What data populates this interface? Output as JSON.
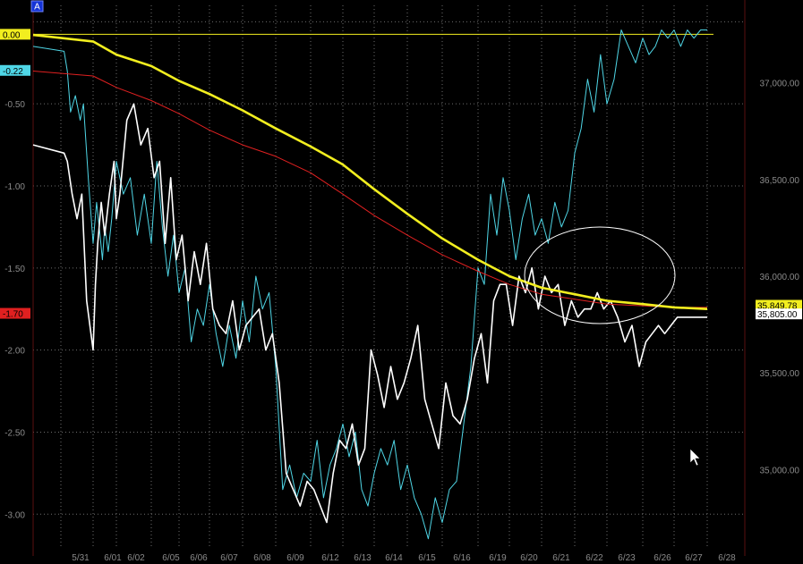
{
  "chart_data": {
    "type": "line",
    "corner_badge": "A",
    "colors": {
      "background": "#000000",
      "grid": "#6e6e6e",
      "left_axis": "#8a8a8a",
      "right_axis": "#8b1a1a",
      "white_series": "#ffffff",
      "cyan_series": "#4fd6e6",
      "yellow_series": "#f2ee1f",
      "red_series": "#e02020",
      "ellipse": "#ffffff"
    },
    "x_labels": [
      "5/31",
      "6/01",
      "6/02",
      "6/05",
      "6/06",
      "6/07",
      "6/08",
      "6/09",
      "6/12",
      "6/13",
      "6/14",
      "6/15",
      "6/16",
      "6/19",
      "6/20",
      "6/21",
      "6/22",
      "6/23",
      "6/26",
      "6/27",
      "6/28"
    ],
    "left_axis": {
      "ylim": [
        -3.2,
        0.1
      ],
      "ticks": [
        0.0,
        -0.5,
        -1.0,
        -1.5,
        -2.0,
        -2.5,
        -3.0
      ],
      "tick_labels": [
        "0.00",
        "-0.50",
        "-1.00",
        "-1.50",
        "-2.00",
        "-2.50",
        "-3.00"
      ],
      "tick_label_shown": [
        false,
        true,
        true,
        true,
        true,
        true,
        true
      ]
    },
    "right_axis": {
      "ylim": [
        34600,
        37400
      ],
      "ticks": [
        37000,
        36500,
        36000,
        35500,
        35000
      ],
      "tick_labels": [
        "37,000.00",
        "36,500.00",
        "36,000.00",
        "35,500.00",
        "35,000.00"
      ]
    },
    "value_tags": [
      {
        "side": "left",
        "text": "0.00",
        "value": 0.0,
        "bg": "#f2ee1f",
        "fg": "#000000"
      },
      {
        "side": "left",
        "text": "-0.22",
        "value": -0.22,
        "bg": "#4fd6e6",
        "fg": "#000000"
      },
      {
        "side": "left",
        "text": "-1.70",
        "value": -1.7,
        "bg": "#e02020",
        "fg": "#000000"
      },
      {
        "side": "right",
        "text": "35,849.78",
        "value": 35849.78,
        "bg": "#f2ee1f",
        "fg": "#000000"
      },
      {
        "side": "right",
        "text": "35,805.00",
        "value": 35805.0,
        "bg": "#ffffff",
        "fg": "#000000"
      }
    ],
    "reference_line": {
      "axis": "left",
      "value": 0.0,
      "color": "#f2ee1f"
    },
    "series": [
      {
        "axis": "left",
        "color_key": "cyan_series",
        "width": 1,
        "x": [
          0.0,
          0.1,
          0.2,
          0.3,
          0.45,
          0.6,
          0.7,
          0.85,
          1.0,
          1.15,
          1.3,
          1.4,
          1.5,
          1.65,
          1.8,
          2.0,
          2.2,
          2.4,
          2.6,
          2.8,
          3.0,
          3.2,
          3.4,
          3.6,
          3.8,
          4.0,
          4.2,
          4.4,
          4.6,
          4.8,
          5.0,
          5.2,
          5.4,
          5.6,
          5.8,
          6.0,
          6.2,
          6.4,
          6.6,
          6.8,
          7.0,
          7.2,
          7.4,
          7.6,
          7.8,
          8.0,
          8.2,
          8.4,
          8.6,
          8.8,
          9.0,
          9.2,
          9.4,
          9.6,
          9.8,
          10.0,
          10.2,
          10.4,
          10.6,
          10.8,
          11.0,
          11.2,
          11.4,
          11.6,
          11.8,
          12.0,
          12.2,
          12.4,
          12.6,
          12.8,
          13.0,
          13.2,
          13.4,
          13.6,
          13.8,
          14.0,
          14.2,
          14.4,
          14.6,
          14.8,
          15.0,
          15.2,
          15.4,
          15.6,
          15.8,
          16.0,
          16.2,
          16.4,
          16.6,
          16.8,
          17.0,
          17.2,
          17.4,
          17.6,
          17.8,
          18.0,
          18.2,
          18.4,
          18.6,
          18.8,
          19.0,
          19.2,
          19.4,
          19.6,
          19.8,
          20.0
        ],
        "values": [
          -0.15,
          -0.18,
          -0.3,
          -0.55,
          -0.45,
          -0.6,
          -0.5,
          -0.95,
          -1.35,
          -1.1,
          -1.3,
          -1.45,
          -1.25,
          -1.4,
          -1.2,
          -0.85,
          -1.05,
          -0.95,
          -1.3,
          -1.05,
          -1.35,
          -0.85,
          -1.25,
          -1.55,
          -1.3,
          -1.65,
          -1.5,
          -1.95,
          -1.75,
          -1.85,
          -1.6,
          -1.9,
          -2.1,
          -1.85,
          -2.05,
          -1.7,
          -1.95,
          -1.55,
          -1.75,
          -1.65,
          -2.1,
          -2.85,
          -2.7,
          -2.9,
          -2.75,
          -2.8,
          -2.55,
          -2.9,
          -2.7,
          -2.6,
          -2.45,
          -2.65,
          -2.5,
          -2.85,
          -2.95,
          -2.75,
          -2.6,
          -2.7,
          -2.55,
          -2.85,
          -2.7,
          -2.9,
          -3.0,
          -3.15,
          -2.9,
          -3.05,
          -2.85,
          -2.8,
          -2.45,
          -2.1,
          -1.5,
          -1.6,
          -1.05,
          -1.3,
          -0.95,
          -1.15,
          -1.45,
          -1.2,
          -1.05,
          -1.3,
          -1.2,
          -1.35,
          -1.1,
          -1.25,
          -1.15,
          -0.8,
          -0.65,
          -0.35,
          -0.55,
          -0.2,
          -0.5,
          -0.35,
          -0.05,
          -0.15,
          -0.25,
          -0.1,
          -0.2,
          -0.15,
          -0.05,
          -0.1,
          -0.05,
          -0.15,
          -0.05,
          -0.1,
          -0.05,
          -0.05
        ],
        "_note_unused": ""
      },
      {
        "axis": "left",
        "color_key": "white_series",
        "width": 1.6,
        "x": [
          0.0,
          0.1,
          0.2,
          0.35,
          0.5,
          0.65,
          0.8,
          1.0,
          1.1,
          1.2,
          1.35,
          1.5,
          1.7,
          1.9,
          2.0,
          2.1,
          2.3,
          2.5,
          2.7,
          2.9,
          3.1,
          3.3,
          3.5,
          3.7,
          3.9,
          4.1,
          4.3,
          4.5,
          4.7,
          4.9,
          5.1,
          5.3,
          5.5,
          5.7,
          5.9,
          6.1,
          6.3,
          6.5,
          6.7,
          6.9,
          7.1,
          7.3,
          7.5,
          7.7,
          7.9,
          8.1,
          8.3,
          8.5,
          8.7,
          8.9,
          9.1,
          9.3,
          9.5,
          9.7,
          9.9,
          10.1,
          10.3,
          10.5,
          10.7,
          10.9,
          11.1,
          11.3,
          11.5,
          11.7,
          11.9,
          12.1,
          12.3,
          12.5,
          12.7,
          12.9,
          13.1,
          13.3,
          13.5,
          13.7,
          13.9,
          14.1,
          14.3,
          14.5,
          14.7,
          14.9,
          15.1,
          15.3,
          15.5,
          15.7,
          15.9,
          16.1,
          16.3,
          16.5,
          16.7,
          16.9,
          17.1,
          17.3,
          17.5,
          17.7,
          17.9,
          18.1,
          18.3,
          18.5,
          18.7,
          18.9,
          19.1,
          19.3,
          19.5,
          19.7,
          19.9,
          20.0
        ],
        "values": [
          -0.75,
          -0.8,
          -0.85,
          -1.05,
          -1.2,
          -1.05,
          -1.7,
          -2.0,
          -1.6,
          -1.35,
          -1.1,
          -1.3,
          -1.05,
          -0.85,
          -1.2,
          -1.05,
          -0.6,
          -0.5,
          -0.75,
          -0.65,
          -0.95,
          -0.85,
          -1.35,
          -0.95,
          -1.45,
          -1.3,
          -1.7,
          -1.4,
          -1.6,
          -1.35,
          -1.75,
          -1.85,
          -1.9,
          -1.7,
          -2.0,
          -1.85,
          -1.8,
          -1.75,
          -2.0,
          -1.9,
          -2.2,
          -2.75,
          -2.85,
          -2.95,
          -2.8,
          -2.85,
          -2.95,
          -3.05,
          -2.75,
          -2.55,
          -2.6,
          -2.45,
          -2.7,
          -2.6,
          -2.0,
          -2.15,
          -2.35,
          -2.1,
          -2.3,
          -2.2,
          -2.05,
          -1.85,
          -2.3,
          -2.45,
          -2.6,
          -2.2,
          -2.4,
          -2.45,
          -2.3,
          -2.05,
          -1.9,
          -2.2,
          -1.7,
          -1.6,
          -1.6,
          -1.85,
          -1.55,
          -1.65,
          -1.5,
          -1.75,
          -1.55,
          -1.65,
          -1.6,
          -1.85,
          -1.7,
          -1.8,
          -1.75,
          -1.75,
          -1.65,
          -1.75,
          -1.7,
          -1.8,
          -1.95,
          -1.85,
          -2.1,
          -1.95,
          -1.9,
          -1.85,
          -1.9,
          -1.85,
          -1.8,
          -1.8,
          -1.8,
          -1.8,
          -1.8,
          -1.8
        ],
        "_note_unused": ""
      },
      {
        "axis": "left",
        "color_key": "red_series",
        "width": 1,
        "x": [
          0.0,
          1.0,
          2.0,
          3.0,
          4.0,
          5.0,
          6.0,
          7.0,
          8.0,
          9.0,
          10.0,
          11.0,
          12.0,
          13.0,
          14.0,
          15.0,
          16.0,
          17.0,
          18.0,
          19.0,
          20.0
        ],
        "values": [
          -0.3,
          -0.33,
          -0.4,
          -0.48,
          -0.56,
          -0.66,
          -0.75,
          -0.82,
          -0.92,
          -1.05,
          -1.18,
          -1.3,
          -1.42,
          -1.52,
          -1.6,
          -1.66,
          -1.69,
          -1.72,
          -1.73,
          -1.74,
          -1.74
        ]
      },
      {
        "axis": "left",
        "color_key": "yellow_series",
        "width": 2.6,
        "x": [
          0.0,
          1.0,
          2.0,
          3.0,
          4.0,
          5.0,
          6.0,
          7.0,
          8.0,
          9.0,
          10.0,
          11.0,
          12.0,
          13.0,
          14.0,
          15.0,
          16.0,
          17.0,
          18.0,
          19.0,
          20.0
        ],
        "values": [
          -0.08,
          -0.12,
          -0.2,
          -0.27,
          -0.36,
          -0.44,
          -0.54,
          -0.65,
          -0.76,
          -0.87,
          -1.02,
          -1.17,
          -1.32,
          -1.45,
          -1.55,
          -1.62,
          -1.66,
          -1.7,
          -1.72,
          -1.74,
          -1.75
        ]
      }
    ]
  }
}
